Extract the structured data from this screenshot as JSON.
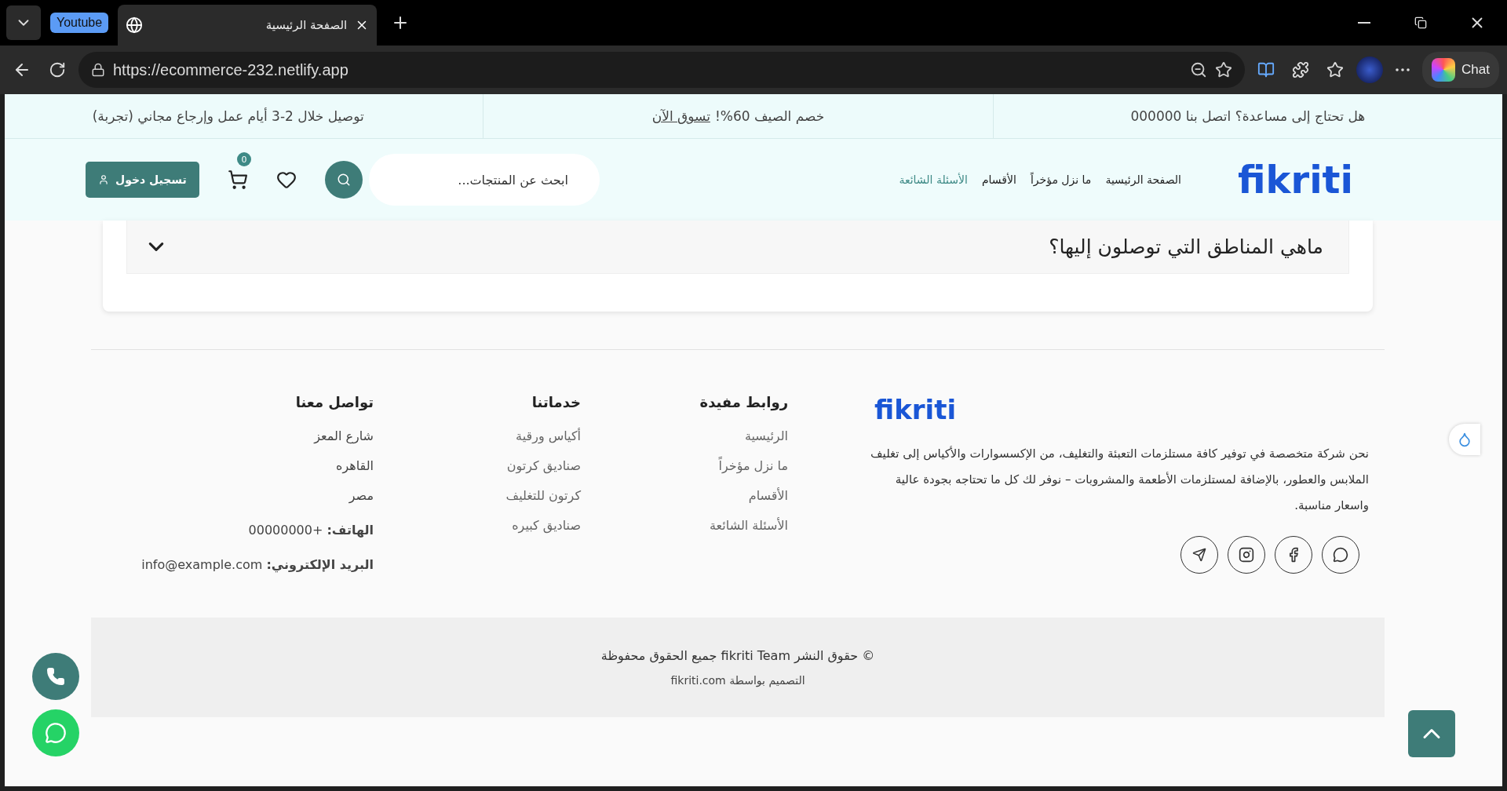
{
  "browser": {
    "tab_group": "Youtube",
    "tabs": [
      {
        "title": "الصفحة الرئيسية",
        "selected": true
      }
    ],
    "url": "https://ecommerce-232.netlify.app",
    "chat_label": "Chat"
  },
  "announcements": [
    "هل تحتاج إلى مساعدة؟ اتصل بنا 000000",
    {
      "text": "خصم الصيف 60%!",
      "link": "تسوق الآن"
    },
    "توصيل خلال 2-3 أيام عمل وإرجاع مجاني (تجربة)"
  ],
  "header": {
    "logo": "fikriti",
    "nav": [
      {
        "label": "الصفحة الرئيسية",
        "selected": false
      },
      {
        "label": "ما نزل مؤخراً",
        "selected": false
      },
      {
        "label": "الأقسام",
        "selected": false
      },
      {
        "label": "الأسئلة الشائعة",
        "selected": true
      }
    ],
    "search": {
      "placeholder": "ابحث عن المنتجات..."
    },
    "cart_count": "0",
    "login": "تسجيل دخول"
  },
  "faq": [
    {
      "question": "ماهي المناطق التي توصلون إليها؟",
      "expanded": false
    }
  ],
  "footer": {
    "logo": "fikriti",
    "about": "نحن شركة متخصصة في توفير كافة مستلزمات التعبئة والتغليف، من الإكسسوارات والأكياس إلى تغليف الملابس والعطور، بالإضافة لمستلزمات الأطعمة والمشروبات – نوفر لك كل ما تحتاجه بجودة عالية واسعار مناسبة.",
    "socials": [
      {
        "kind": "whatsapp"
      },
      {
        "kind": "facebook"
      },
      {
        "kind": "instagram"
      },
      {
        "kind": "telegram"
      }
    ],
    "columns": [
      {
        "title": "روابط مفيدة",
        "links": [
          "الرئيسية",
          "ما نزل مؤخراً",
          "الأقسام",
          "الأسئلة الشائعة"
        ]
      },
      {
        "title": "خدماتنا",
        "links": [
          "أكياس ورقية",
          "صناديق كرتون",
          "كرتون للتغليف",
          "صناديق كبيره"
        ]
      }
    ],
    "contact": {
      "title": "تواصل معنا",
      "lines": [
        "شارع المعز",
        "القاهره",
        "مصر"
      ],
      "details": [
        {
          "label": "الهاتف:",
          "value": "+00000000"
        },
        {
          "label": "البريد الإلكتروني:",
          "value": "info@example.com"
        }
      ]
    },
    "copyright": {
      "prefix": "© حقوق النشر",
      "brand": "fikriti Team",
      "suffix": "جميع الحقوق محفوظة",
      "credit": "التصميم بواسطة fikriti.com"
    }
  }
}
